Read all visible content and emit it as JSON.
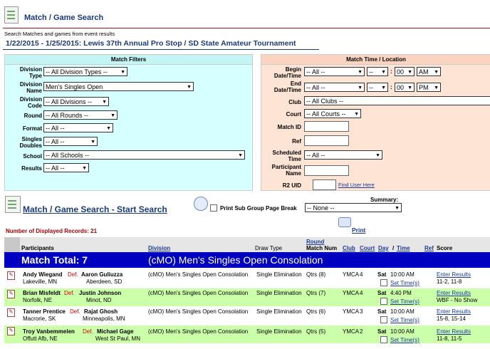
{
  "header": {
    "title": "Match / Game Search",
    "subtext": "Search Matches and games from event results",
    "event": "1/22/2015 - 1/25/2015: Lewis 37th Annual Pro Stop / SD State Amateur Tournament"
  },
  "filters": {
    "heading": "Match Filters",
    "division_type": {
      "label": "Division Type",
      "value": "-- All Division Types --"
    },
    "division_name": {
      "label": "Division Name",
      "value": "Men's Singles Open"
    },
    "division_code": {
      "label": "Division Code",
      "value": "-- All Divisions --"
    },
    "round": {
      "label": "Round",
      "value": "-- All Rounds --"
    },
    "format": {
      "label": "Format",
      "value": "-- All --"
    },
    "singles_doubles": {
      "label": "Singles Doubles",
      "value": "-- All --"
    },
    "school": {
      "label": "School",
      "value": "-- All Schools --"
    },
    "results": {
      "label": "Results",
      "value": "-- All --"
    }
  },
  "time_location": {
    "heading": "Match Time / Location",
    "begin": {
      "label": "Begin Date/Time",
      "date": "-- All --",
      "day": "--",
      "hour": "--",
      "minute": "00",
      "ampm": "AM"
    },
    "end": {
      "label": "End Date/Time",
      "date": "-- All --",
      "day": "--",
      "hour": "--",
      "minute": "00",
      "ampm": "PM"
    },
    "club": {
      "label": "Club",
      "value": "-- All Clubs --"
    },
    "court": {
      "label": "Court",
      "value": "-- All Courts --"
    },
    "match_id": {
      "label": "Match ID"
    },
    "ref": {
      "label": "Ref"
    },
    "scheduled_time": {
      "label": "Scheduled Time",
      "value": "-- All --"
    },
    "participant_name": {
      "label": "Participant Name"
    },
    "r2_uid": {
      "label": "R2 UID"
    },
    "find_user": "Find User Here"
  },
  "search": {
    "start_label": "Match / Game Search - Start Search",
    "print_sub_group": "Print Sub Group Page Break",
    "summary_label": "Summary:",
    "summary_value": "-- None --",
    "records_label": "Number of Displayed Records: 21",
    "print_label": "Print"
  },
  "table": {
    "headers": {
      "participants": "Participants",
      "division": "Division",
      "draw_type": "Draw Type",
      "round_match": "Round",
      "match_num": "Match Num",
      "club": "Club",
      "court": "Court",
      "day": "Day",
      "slash": "/",
      "time": "Time",
      "ref": "Ref",
      "score": "Score"
    },
    "total": {
      "label": "Match Total: 7",
      "division": "(cMO) Men's Singles Open Consolation"
    },
    "rows": [
      {
        "p1": "Andy Wiegand",
        "def": "Def.",
        "p2": "Aaron Guliuzza",
        "loc1": "Lakeville, MN",
        "loc2": "Aberdeen, SD",
        "division": "(cMO) Men's Singles Open Consolation",
        "draw": "Single Elimination",
        "round": "Qtrs (8)",
        "club": "YMCA",
        "court": "4",
        "day": "Sat",
        "time": "10:00 AM",
        "settime": "Set Time(s)",
        "enter": "Enter Results",
        "score": "11-2, 11-8"
      },
      {
        "p1": "Brian Misfeldt",
        "def": "Def.",
        "p2": "Justin Johnson",
        "loc1": "Norfolk, NE",
        "loc2": "Minot, ND",
        "division": "(cMO) Men's Singles Open Consolation",
        "draw": "Single Elimination",
        "round": "Qtrs (7)",
        "club": "YMCA",
        "court": "4",
        "day": "Sat",
        "time": "4:40 PM",
        "settime": "Set Time(s)",
        "enter": "Enter Results",
        "score": "WBF - No Show"
      },
      {
        "p1": "Tanner Prentice",
        "def": "Def.",
        "p2": "Rajat Ghosh",
        "loc1": "Macrorie, SK",
        "loc2": "Minneapolis, MN",
        "division": "(cMO) Men's Singles Open Consolation",
        "draw": "Single Elimination",
        "round": "Qtrs (6)",
        "club": "YMCA",
        "court": "3",
        "day": "Sat",
        "time": "10:00 AM",
        "settime": "Set Time(s)",
        "enter": "Enter Results",
        "score": "15-8, 15-14"
      },
      {
        "p1": "Troy Vanbemmelen",
        "def": "Def.",
        "p2": "Michael Gage",
        "loc1": "Offutt Afb, NE",
        "loc2": "West St Paul, MN",
        "division": "(cMO) Men's Singles Open Consolation",
        "draw": "Single Elimination",
        "round": "Qtrs (5)",
        "club": "YMCA",
        "court": "2",
        "day": "Sat",
        "time": "10:00 AM",
        "settime": "Set Time(s)",
        "enter": "Enter Results",
        "score": "11-8, 11-5"
      }
    ]
  }
}
